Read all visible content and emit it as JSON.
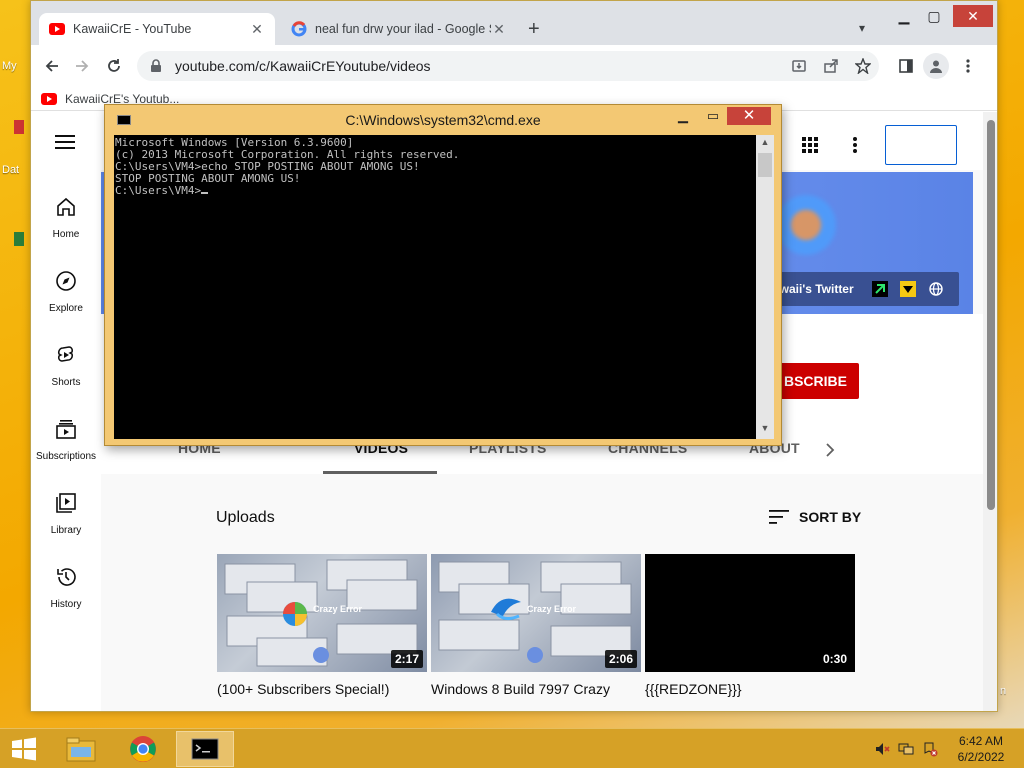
{
  "desktop": {
    "fragments": [
      "My",
      "Dat",
      "n"
    ]
  },
  "browser": {
    "tabs": [
      {
        "title": "KawaiiCrE - YouTube",
        "active": true
      },
      {
        "title": "neal fun drw your ilad - Google S",
        "active": false
      }
    ],
    "new_tab": "+",
    "address": "youtube.com/c/KawaiiCrEYoutube/videos",
    "bookmark": "KawaiiCrE's Youtub..."
  },
  "youtube": {
    "sidebar": [
      {
        "label": "Home",
        "icon": "home-icon"
      },
      {
        "label": "Explore",
        "icon": "compass-icon"
      },
      {
        "label": "Shorts",
        "icon": "shorts-icon"
      },
      {
        "label": "Subscriptions",
        "icon": "subscriptions-icon"
      },
      {
        "label": "Library",
        "icon": "library-icon"
      },
      {
        "label": "History",
        "icon": "history-icon"
      }
    ],
    "banner_link": "awaii's Twitter",
    "subscribe": "BSCRIBE",
    "tabs": [
      "HOME",
      "VIDEOS",
      "PLAYLISTS",
      "CHANNELS",
      "ABOUT"
    ],
    "active_tab": "VIDEOS",
    "uploads": "Uploads",
    "sort_by": "SORT BY",
    "videos": [
      {
        "title": "(100+ Subscribers Special!)",
        "duration": "2:17",
        "caption": "Crazy Error"
      },
      {
        "title": "Windows 8 Build 7997 Crazy",
        "duration": "2:06",
        "caption": "Crazy Error"
      },
      {
        "title": "{{{REDZONE}}}",
        "duration": "0:30",
        "caption": ""
      }
    ]
  },
  "cmd": {
    "title": "C:\\Windows\\system32\\cmd.exe",
    "lines": [
      "Microsoft Windows [Version 6.3.9600]",
      "(c) 2013 Microsoft Corporation. All rights reserved.",
      "",
      "C:\\Users\\VM4>echo STOP POSTING ABOUT AMONG US!",
      "STOP POSTING ABOUT AMONG US!",
      "",
      "C:\\Users\\VM4>"
    ]
  },
  "taskbar": {
    "time": "6:42 AM",
    "date": "6/2/2022"
  },
  "colors": {
    "desktop": "#f5b400",
    "taskbar": "#d6a126",
    "cmd_frame": "#f3c873",
    "youtube_red": "#ff0000",
    "subscribe": "#cc0000"
  }
}
